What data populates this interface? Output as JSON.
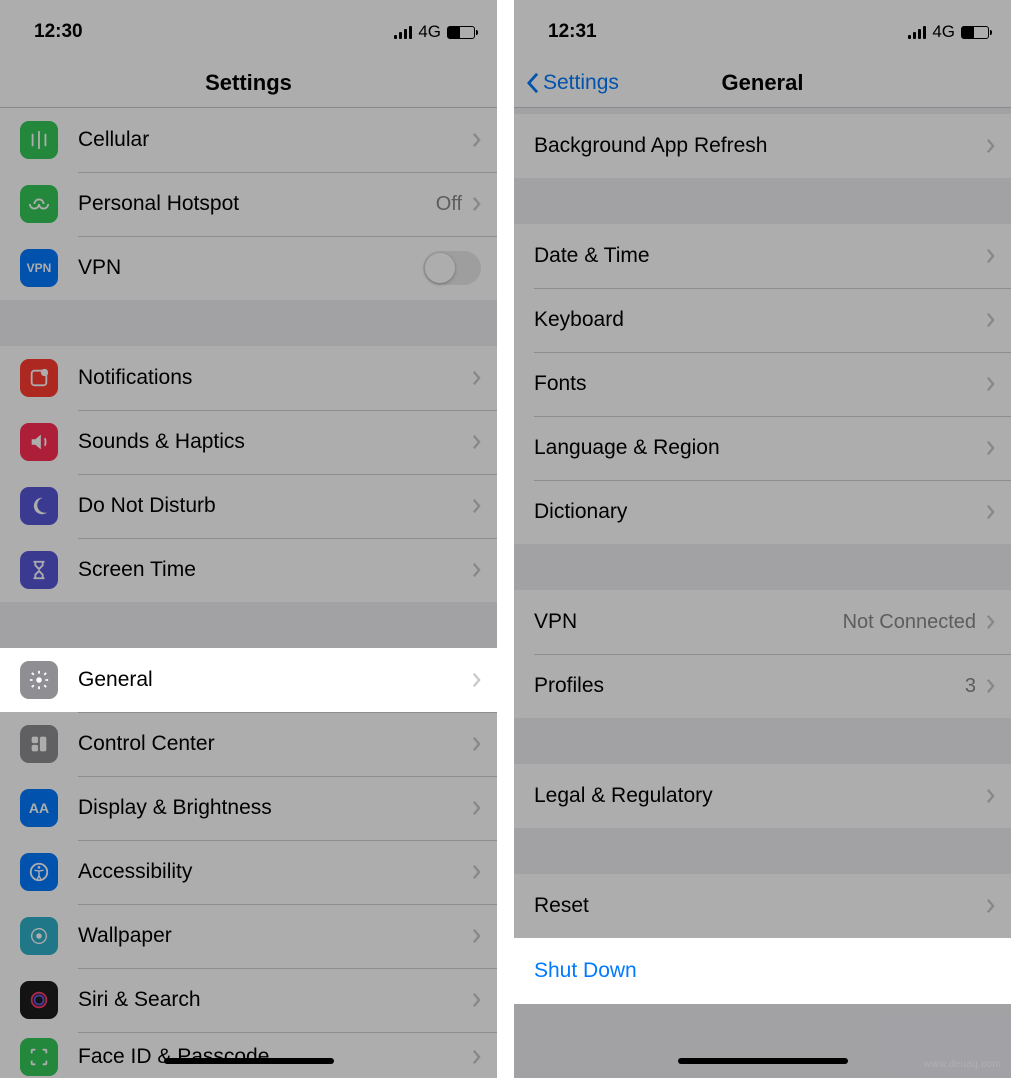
{
  "left": {
    "status": {
      "time": "12:30",
      "network": "4G"
    },
    "header": {
      "title": "Settings"
    },
    "group1": {
      "cellular": "Cellular",
      "hotspot": "Personal Hotspot",
      "hotspot_value": "Off",
      "vpn": "VPN"
    },
    "group2": {
      "notifications": "Notifications",
      "sounds": "Sounds & Haptics",
      "dnd": "Do Not Disturb",
      "screentime": "Screen Time"
    },
    "group3": {
      "general": "General",
      "control_center": "Control Center",
      "display": "Display & Brightness",
      "accessibility": "Accessibility",
      "wallpaper": "Wallpaper",
      "siri": "Siri & Search",
      "faceid": "Face ID & Passcode"
    }
  },
  "right": {
    "status": {
      "time": "12:31",
      "network": "4G"
    },
    "header": {
      "back": "Settings",
      "title": "General"
    },
    "group1": {
      "bg_refresh": "Background App Refresh"
    },
    "group2": {
      "date_time": "Date & Time",
      "keyboard": "Keyboard",
      "fonts": "Fonts",
      "language": "Language & Region",
      "dictionary": "Dictionary"
    },
    "group3": {
      "vpn": "VPN",
      "vpn_value": "Not Connected",
      "profiles": "Profiles",
      "profiles_value": "3"
    },
    "group4": {
      "legal": "Legal & Regulatory"
    },
    "group5": {
      "reset": "Reset"
    },
    "shutdown": "Shut Down"
  },
  "watermark": "www.deuaq.com"
}
